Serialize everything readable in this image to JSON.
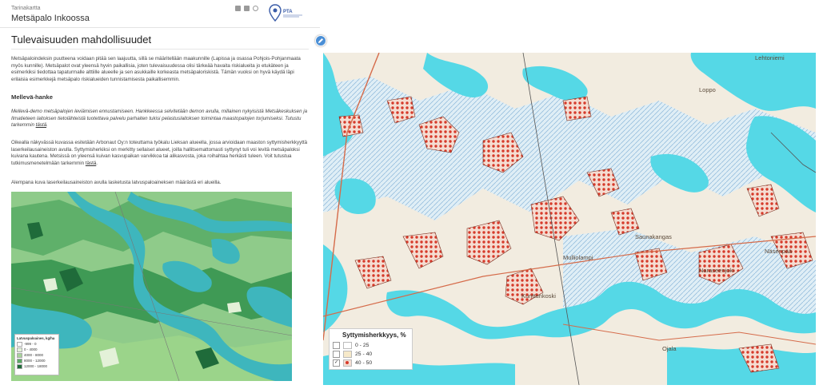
{
  "header": {
    "subtitle": "Tarinakartta",
    "title": "Metsäpalo Inkoossa",
    "logo_text": "PTA"
  },
  "section": {
    "title": "Tulevaisuuden mahdollisuudet"
  },
  "paragraphs": {
    "intro": "Metsäpaloindeksin puutteena voidaan pitää sen laajuutta, sillä se määritellään maakunnille (Lapissa ja osassa Pohjois-Pohjanmaata myös kunnille). Metsäpalot ovat yleensä hyvin paikallisia, joten tulevaisuudessa olisi tärkeää havaita riskialueita jo etukäteen ja esimerkiksi tiedottaa tapaturmalle alttiille alueelle ja sen asukkaille korkeasta metsäpaloriskistä. Tämän vuoksi on hyvä käydä läpi erilaisia esimerkkejä metsäpalo riskialueiden tunnistamisesta paikallisemmin.",
    "subheading": "Mellevä-hanke",
    "mellev_a": "Mellevä-demo metsäpalojen leviämisen ennustamiseen. Hankkeessa selvitetään demon avulla, millainen nykyisistä Metsäkeskuksen ja Ilmatieteen laitoksen tietolähteistä tuotettava palvelu parhaiten tukisi pelastuslaitoksen toimintaa maastopalojen torjumiseksi. Tutustu tarkemmin ",
    "link1": "tästä",
    "period1": ".",
    "arbo_a": "Oikealla näkyvässä kuvassa esitetään Arbonaut Oy:n toteuttama työkalu Lieksan alueella, jossa arvioidaan maaston syttymisherkkyyttä laserkeilausaineiston avulla. Syttymisherkiksi on merkitty sellaiset alueet, joilla hallitsemattomasti syttynyt tuli voi levitä metsäpaloksi kuivana kautena. Metsissä on yleensä kuivan kasvupaikan varvikkoa tai alikasvosta, joka roihahtaa herkästi tuleen. Voit tutustua tutkimusmenetelmään tarkemmin ",
    "link2": "tästä",
    "period2": ".",
    "last": "Alempana kuva laserkeilausaineiston avulla lasketusta latvuspaloaineksen määrästä eri alueilla."
  },
  "thumb_legend": {
    "title": "Latvuspaloaines, kg/ha",
    "items": [
      "-999 - 0",
      "0 - 4000",
      "4000 - 8000",
      "8000 - 12000",
      "12000 - 18000"
    ],
    "colors": [
      "#ffffff",
      "#e3f1d8",
      "#a7d39a",
      "#5aa865",
      "#1f6b3a"
    ]
  },
  "map": {
    "labels": [
      "Lehtoniemi",
      "Loppo",
      "Saunakangas",
      "Naraseenjoki",
      "Näsenpää",
      "Ojala",
      "Kunttunkoski",
      "Mulliolampi"
    ],
    "legend": {
      "title": "Syttymisherkkyys, %",
      "items": [
        {
          "label": "0 - 25",
          "checked": false,
          "color": "#ffffff"
        },
        {
          "label": "25 - 40",
          "checked": false,
          "color": "#f6e9c9"
        },
        {
          "label": "40 - 50",
          "checked": true,
          "color": "#e03a2a"
        }
      ]
    },
    "colors": {
      "water": "#55d8e6",
      "land": "#f2ece0",
      "wetland": "#cfe3f2",
      "hazard": "#d63a2a",
      "road": "#d56b4a"
    }
  },
  "icons": {
    "facebook": "facebook-icon",
    "twitter": "twitter-icon",
    "link": "link-icon",
    "edit": "pencil-icon"
  }
}
